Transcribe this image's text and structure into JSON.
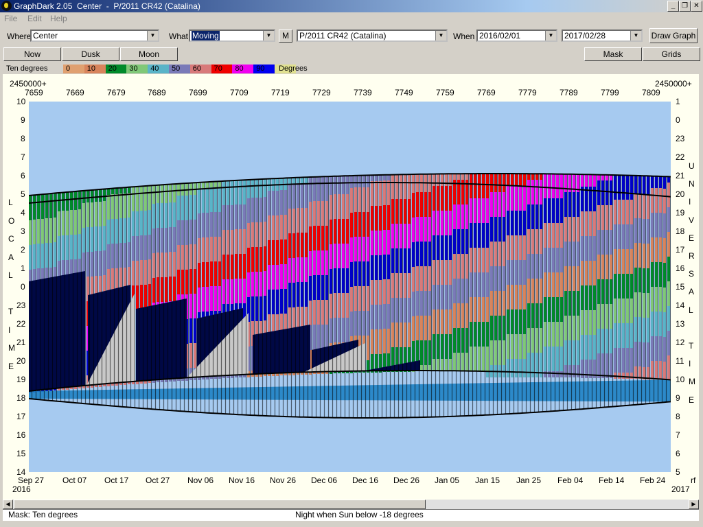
{
  "window": {
    "title": "GraphDark 2.05  Center  -  P/2011 CR42 (Catalina)",
    "minimize": "_",
    "restore": "❐",
    "close": "✕"
  },
  "menu": [
    {
      "label": "File"
    },
    {
      "label": "Edit"
    },
    {
      "label": "Help"
    }
  ],
  "toolbar": {
    "where_label": "Where",
    "where_value": "Center",
    "what_label": "What",
    "what_value": "Moving",
    "m_button": "M",
    "object_value": "P/2011 CR42 (Catalina)",
    "when_label": "When",
    "start_date": "2016/02/01",
    "end_date": "2017/02/28",
    "draw_graph": "Draw Graph"
  },
  "buttons": {
    "now": "Now",
    "dusk": "Dusk",
    "moon": "Moon",
    "mask": "Mask",
    "grids": "Grids"
  },
  "scale": {
    "title": "Ten degrees",
    "labels": [
      "0",
      "10",
      "20",
      "30",
      "40",
      "50",
      "60",
      "70",
      "80",
      "90"
    ],
    "colors": [
      "#e0a070",
      "#d8845c",
      "#008a2a",
      "#80c878",
      "#5ab4c8",
      "#7a7ab8",
      "#d87a7a",
      "#f00000",
      "#f000f0",
      "#0000f0",
      "#e0e090"
    ],
    "unit": "Degrees"
  },
  "axes": {
    "jd_base": "2450000+",
    "jd_base_right": "2450000+",
    "jd_ticks": [
      "7659",
      "7669",
      "7679",
      "7689",
      "7699",
      "7709",
      "7719",
      "7729",
      "7739",
      "7749",
      "7759",
      "7769",
      "7779",
      "7789",
      "7799",
      "7809"
    ],
    "left_hours": [
      "10",
      "9",
      "8",
      "7",
      "6",
      "5",
      "4",
      "3",
      "2",
      "1",
      "0",
      "23",
      "22",
      "21",
      "20",
      "19",
      "18",
      "17",
      "16",
      "15",
      "14"
    ],
    "right_hours": [
      "1",
      "0",
      "23",
      "22",
      "21",
      "20",
      "19",
      "18",
      "17",
      "16",
      "15",
      "14",
      "13",
      "12",
      "11",
      "10",
      "9",
      "8",
      "7",
      "6",
      "5"
    ],
    "left_title": [
      "L",
      "O",
      "C",
      "A",
      "L",
      "",
      "T",
      "I",
      "M",
      "E"
    ],
    "right_title": [
      "U",
      "N",
      "I",
      "V",
      "E",
      "R",
      "S",
      "A",
      "L",
      "",
      "T",
      "I",
      "M",
      "E"
    ],
    "date_ticks": [
      "Sep 27",
      "Oct 07",
      "Oct 17",
      "Oct 27",
      "Nov 06",
      "Nov 16",
      "Nov 26",
      "Dec 06",
      "Dec 16",
      "Dec 26",
      "Jan 05",
      "Jan 15",
      "Jan 25",
      "Feb 04",
      "Feb 14",
      "Feb 24"
    ],
    "year_left": "2016",
    "year_right": "2017",
    "corner": "rf"
  },
  "status": {
    "mask": "Mask:  Ten degrees",
    "night": "Night when Sun below -18 degrees"
  }
}
